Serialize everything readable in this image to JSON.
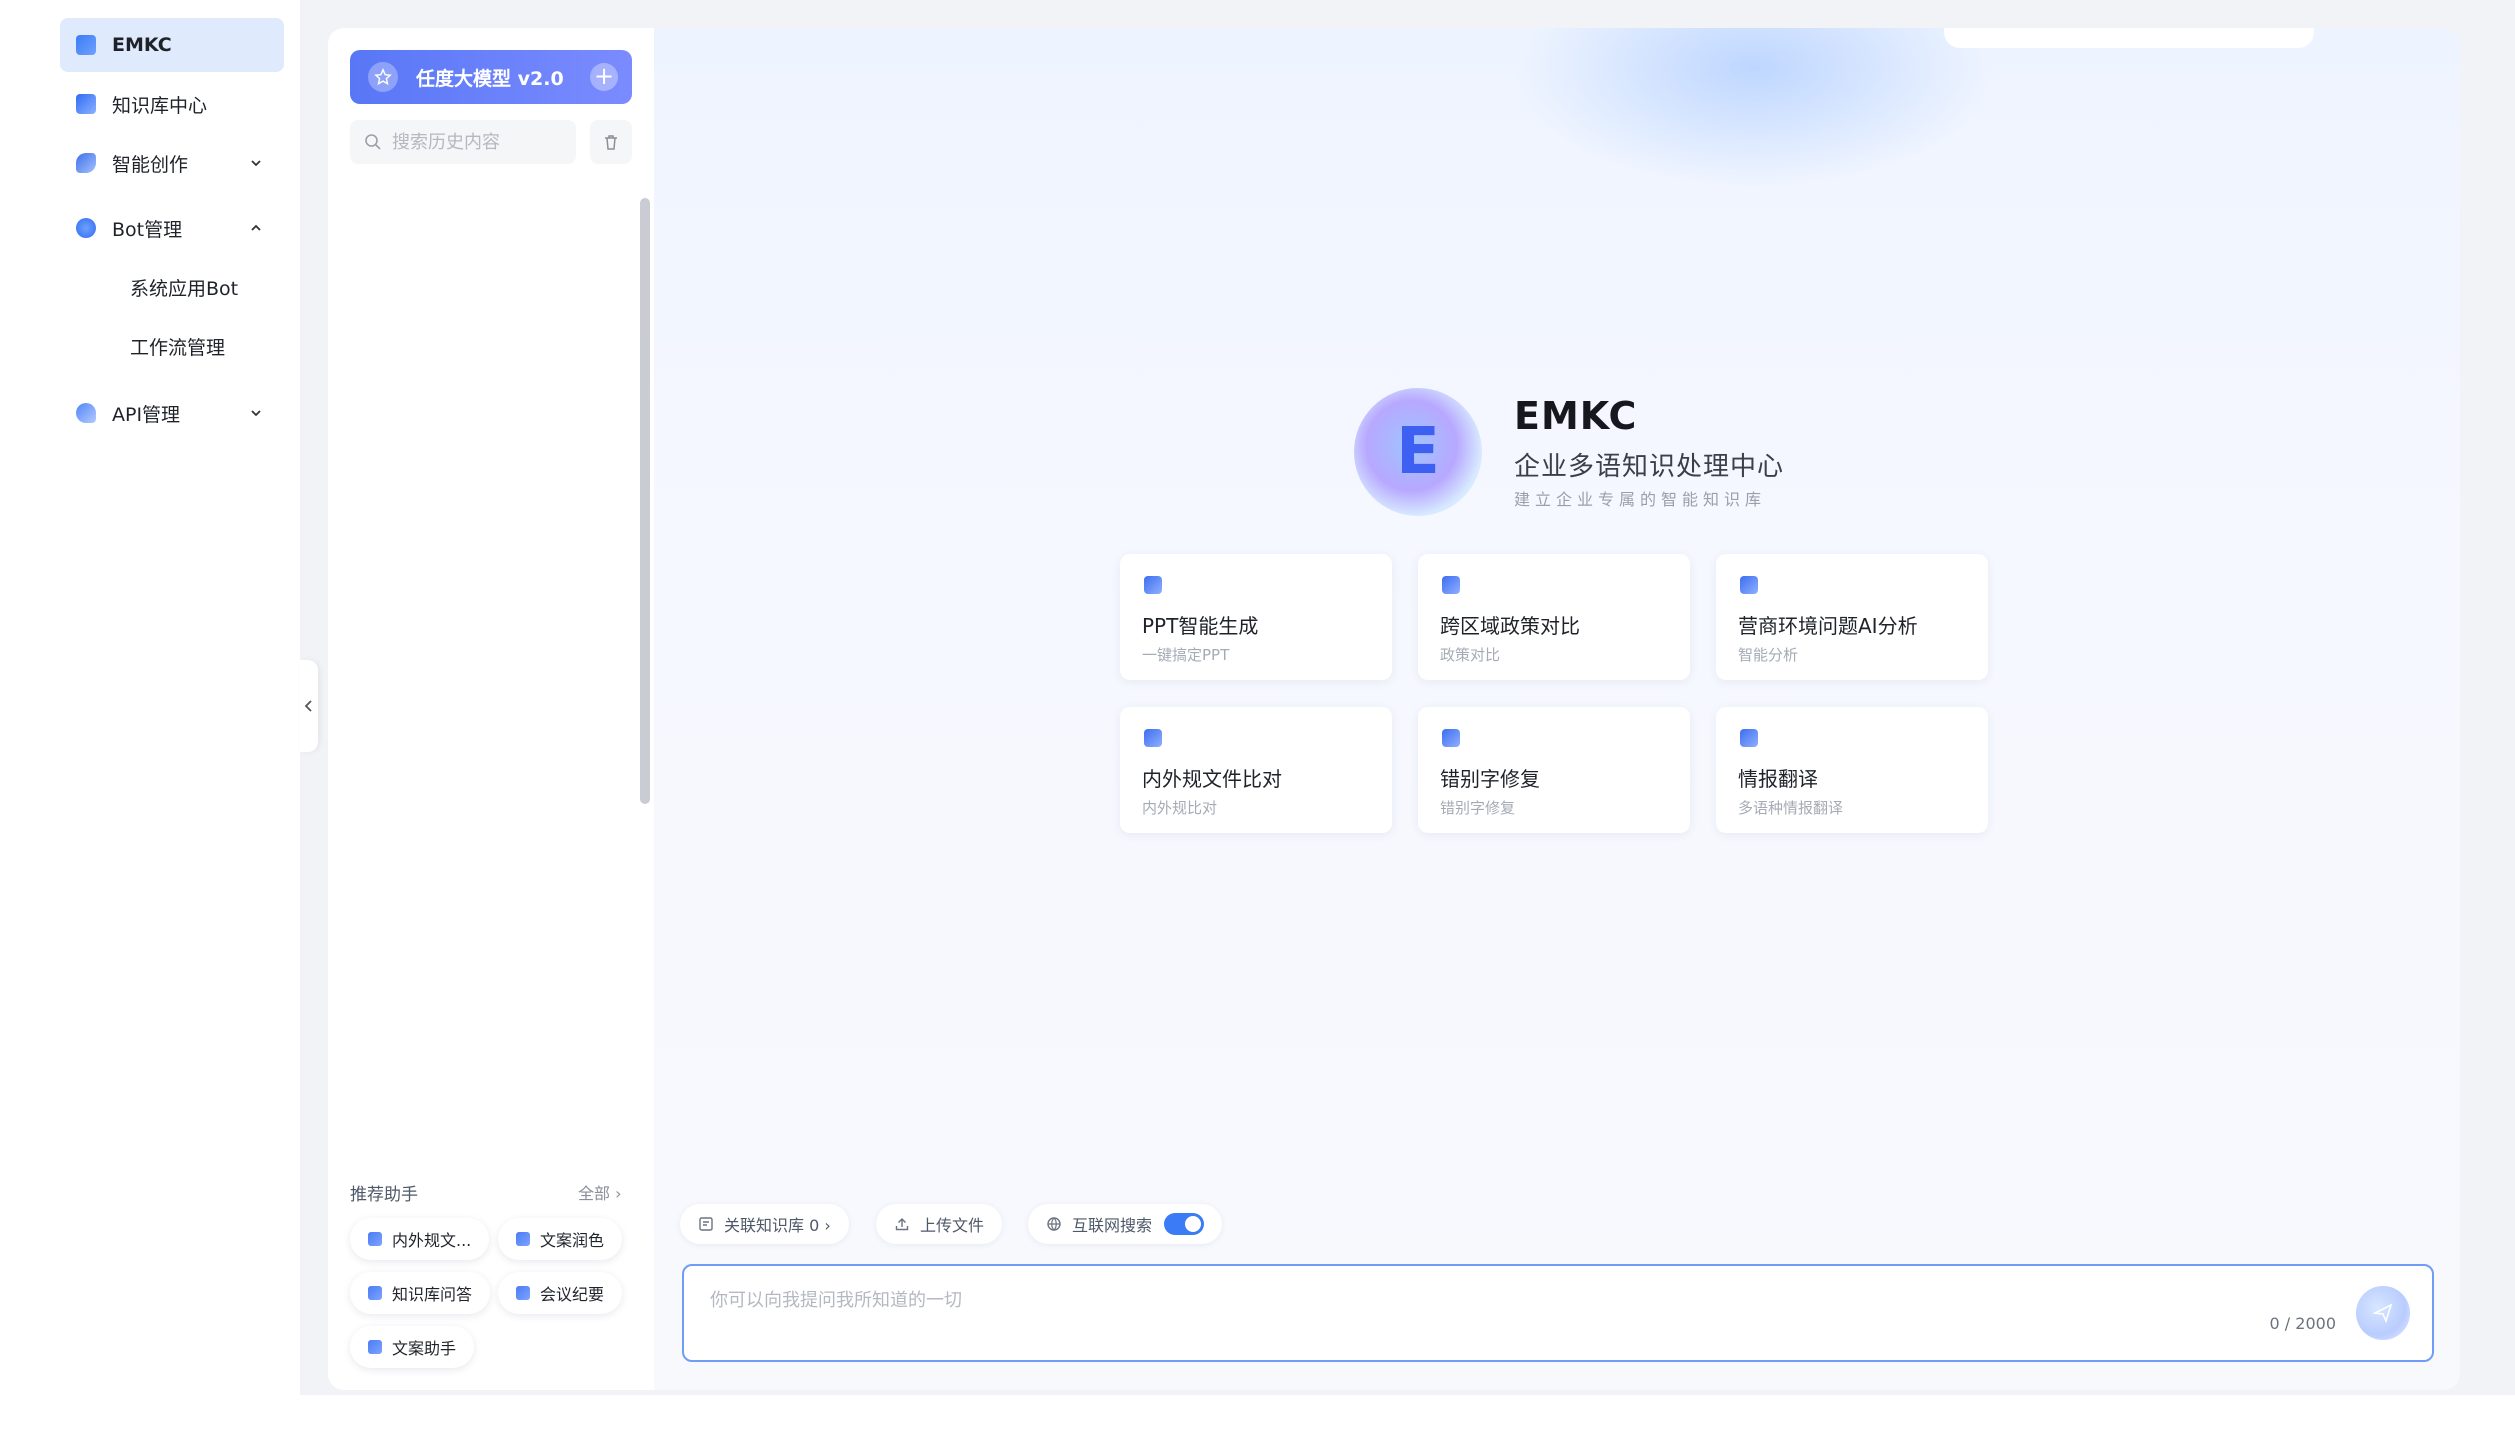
{
  "sidebar": {
    "items": [
      {
        "label": "EMKC"
      },
      {
        "label": "知识库中心"
      },
      {
        "label": "智能创作"
      },
      {
        "label": "Bot管理"
      },
      {
        "label": "API管理"
      }
    ],
    "bot_sub": [
      "系统应用Bot",
      "工作流管理"
    ]
  },
  "history": {
    "new_chat_label": "任度大模型 v2.0",
    "search_placeholder": "搜索历史内容",
    "recommend_title": "推荐助手",
    "recommend_all": "全部 ›",
    "assistants": [
      "内外规文...",
      "文案润色",
      "知识库问答",
      "会议纪要",
      "文案助手"
    ]
  },
  "hero": {
    "title": "EMKC",
    "subtitle": "企业多语知识处理中心",
    "tagline": "建立企业专属的智能知识库",
    "logo_letter": "E"
  },
  "cards": [
    {
      "title": "PPT智能生成",
      "desc": "一键搞定PPT"
    },
    {
      "title": "跨区域政策对比",
      "desc": "政策对比"
    },
    {
      "title": "营商环境问题AI分析",
      "desc": "智能分析"
    },
    {
      "title": "内外规文件比对",
      "desc": "内外规比对"
    },
    {
      "title": "错别字修复",
      "desc": "错别字修复"
    },
    {
      "title": "情报翻译",
      "desc": "多语种情报翻译"
    }
  ],
  "toolbar": {
    "kb_link": "关联知识库 0 ›",
    "upload": "上传文件",
    "web_search": "互联网搜索",
    "web_search_on": true
  },
  "composer": {
    "placeholder": "你可以向我提问我所知道的一切",
    "counter": "0 / 2000"
  },
  "colors": {
    "accent": "#3b7cf6",
    "active_nav_bg": "#dfeafd",
    "composer_border": "#6f9cf7"
  }
}
